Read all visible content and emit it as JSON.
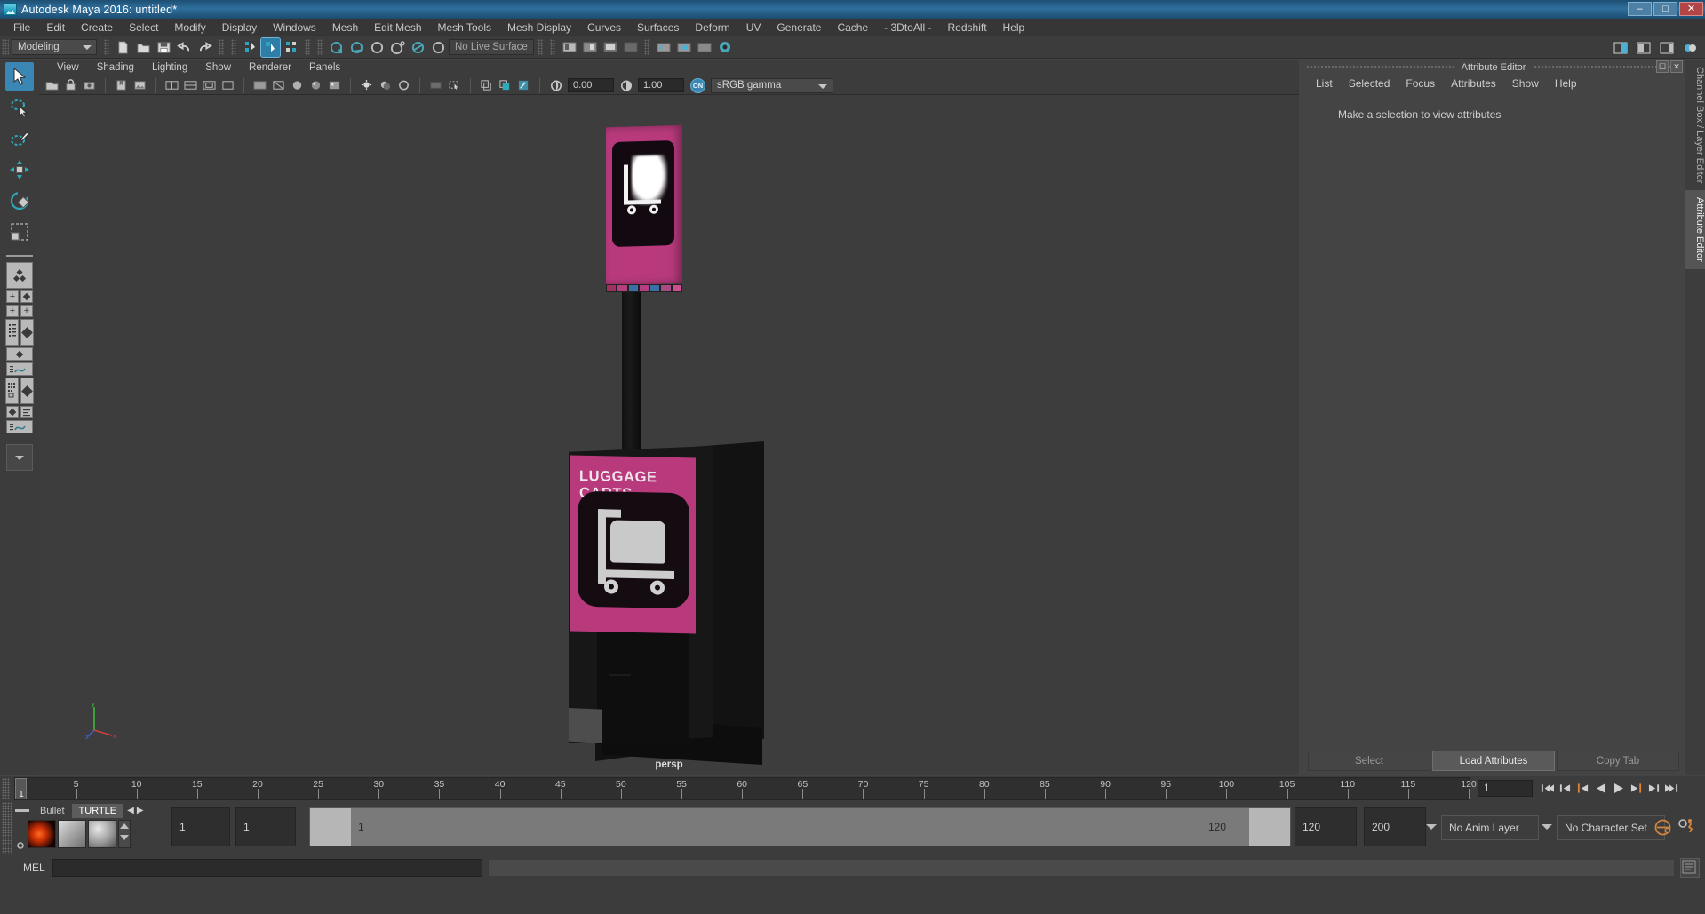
{
  "window": {
    "title": "Autodesk Maya 2016: untitled*",
    "logo_icon": "maya-logo-icon",
    "minimize_label": "–",
    "maximize_label": "□",
    "close_label": "✕"
  },
  "main_menu": {
    "items": [
      "File",
      "Edit",
      "Create",
      "Select",
      "Modify",
      "Display",
      "Windows",
      "Mesh",
      "Edit Mesh",
      "Mesh Tools",
      "Mesh Display",
      "Curves",
      "Surfaces",
      "Deform",
      "UV",
      "Generate",
      "Cache",
      "- 3DtoAll -",
      "Redshift",
      "Help"
    ]
  },
  "toolbar": {
    "menu_set": "Modeling",
    "live_surface": "No Live Surface",
    "icons": [
      "new-scene-icon",
      "open-scene-icon",
      "save-scene-icon",
      "undo-icon",
      "redo-icon",
      "select-by-hierarchy-icon",
      "select-by-object-icon",
      "select-by-component-icon",
      "snap-to-grid-icon",
      "snap-to-curve-icon",
      "snap-to-point-icon",
      "snap-to-projected-center-icon",
      "snap-to-view-plane-icon",
      "make-live-icon",
      "render-current-frame-icon",
      "ipr-render-icon",
      "render-settings-icon",
      "hypershade-icon",
      "render-view-icon",
      "render-globals-icon",
      "show-hide-icon",
      "construction-history-icon"
    ],
    "right_icons": [
      "sidebar-toggle-icon",
      "attribute-editor-toggle-icon",
      "tool-settings-toggle-icon",
      "channel-box-toggle-icon"
    ]
  },
  "viewport": {
    "menu": [
      "View",
      "Shading",
      "Lighting",
      "Show",
      "Renderer",
      "Panels"
    ],
    "camera_label": "persp",
    "exposure_value": "0.00",
    "gamma_value": "1.00",
    "color_management_toggle": "ON",
    "color_profile": "sRGB gamma",
    "toolbar_icons": [
      "select-camera-icon",
      "lock-camera-icon",
      "camera-attributes-icon",
      "bookmarks-icon",
      "image-plane-icon",
      "two-pane-icon",
      "grid-toggle-icon",
      "film-gate-icon",
      "resolution-gate-icon",
      "gate-mask-icon",
      "wireframe-icon",
      "smooth-shade-icon",
      "smooth-shade-all-icon",
      "shaded-textured-icon",
      "use-all-lights-icon",
      "shadows-icon",
      "screen-space-ao-icon",
      "motion-blur-icon",
      "multisample-icon",
      "depth-peeling-icon",
      "xray-icon",
      "xray-joints-icon",
      "xray-active-components-icon",
      "exposure-icon",
      "contrast-icon"
    ],
    "axis_gizmo": {
      "x": "x",
      "y": "y",
      "z": "z"
    }
  },
  "model": {
    "sign_text": "LUGGAGE CARTS",
    "description_icon": "luggage-cart-icon"
  },
  "attribute_editor": {
    "panel_title": "Attribute Editor",
    "menu": [
      "List",
      "Selected",
      "Focus",
      "Attributes",
      "Show",
      "Help"
    ],
    "empty_message": "Make a selection to view attributes",
    "buttons": [
      {
        "label": "Select",
        "enabled": false
      },
      {
        "label": "Load Attributes",
        "enabled": true
      },
      {
        "label": "Copy Tab",
        "enabled": false
      }
    ],
    "float_icon": "undock-icon",
    "close_icon": "close-icon"
  },
  "right_tabs": [
    {
      "label": "Channel Box / Layer Editor",
      "selected": false
    },
    {
      "label": "Attribute Editor",
      "selected": true
    }
  ],
  "timeline": {
    "ticks": [
      5,
      10,
      15,
      20,
      25,
      30,
      35,
      40,
      45,
      50,
      55,
      60,
      65,
      70,
      75,
      80,
      85,
      90,
      95,
      100,
      105,
      110,
      115,
      120
    ],
    "start": 1,
    "end": 120,
    "current_frame": "1",
    "current_frame_field": "1",
    "transport_icons": [
      "go-to-start-icon",
      "step-back-keyframe-icon",
      "step-back-frame-icon",
      "play-backwards-icon",
      "play-forwards-icon",
      "step-forward-frame-icon",
      "step-forward-keyframe-icon",
      "go-to-end-icon"
    ]
  },
  "range_slider": {
    "anim_start": "1",
    "range_start": "1",
    "range_bar_start": "1",
    "range_bar_end": "120",
    "range_end": "120",
    "anim_end": "200",
    "anim_layer": "No Anim Layer",
    "character_set": "No Character Set",
    "auto_key_icon": "auto-keyframe-icon",
    "anim_prefs_icon": "animation-preferences-icon"
  },
  "shelf": {
    "tabs": [
      {
        "label": "Bullet",
        "selected": false
      },
      {
        "label": "TURTLE",
        "selected": true
      }
    ],
    "prev_icon": "chevron-left-icon",
    "next_icon": "chevron-right-icon",
    "menu_icon": "shelf-menu-icon",
    "settings_icon": "shelf-settings-icon",
    "items": [
      "turtle-render-icon",
      "turtle-bake-icon",
      "turtle-material-icon"
    ]
  },
  "command_line": {
    "language_label": "MEL",
    "input_value": "",
    "output_value": "",
    "script_editor_icon": "script-editor-icon"
  },
  "toolbox": {
    "items": [
      {
        "name": "select-tool",
        "selected": true
      },
      {
        "name": "lasso-select-tool",
        "selected": false
      },
      {
        "name": "paint-select-tool",
        "selected": false
      },
      {
        "name": "move-tool",
        "selected": false
      },
      {
        "name": "rotate-tool",
        "selected": false
      },
      {
        "name": "scale-tool",
        "selected": false
      }
    ],
    "layout_presets": [
      "single-perspective-layout",
      "four-view-layout",
      "outliner-persp-layout",
      "persp-graph-layout",
      "hypershade-persp-layout",
      "persp-outliner-graph-layout"
    ]
  },
  "colors": {
    "accent_blue": "#3a86b5",
    "panel_bg": "#3c3c3c",
    "viewport_bg": "#3d3d3d",
    "sign_magenta": "#b83a7d",
    "title_blue": "#2f6f9c"
  }
}
